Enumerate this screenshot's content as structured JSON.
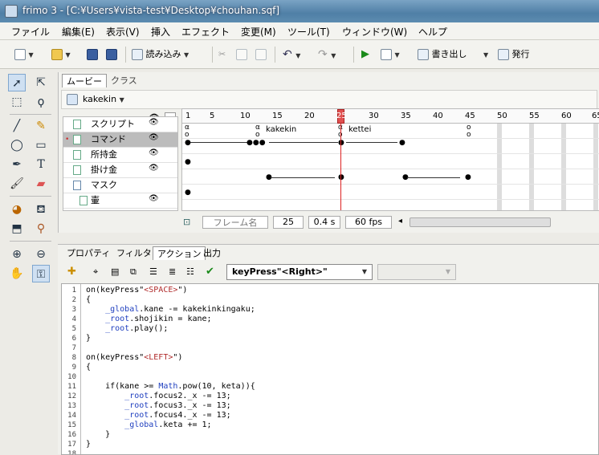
{
  "window": {
    "title": "frimo 3 - [C:¥Users¥vista-test¥Desktop¥chouhan.sqf]"
  },
  "menu": [
    "ファイル",
    "編集(E)",
    "表示(V)",
    "挿入",
    "エフェクト",
    "変更(M)",
    "ツール(T)",
    "ウィンドウ(W)",
    "ヘルプ"
  ],
  "toolbar": {
    "import_label": "読み込み",
    "export_label": "書き出し",
    "publish_label": "発行"
  },
  "timeline": {
    "tabs": [
      "ムービー",
      "クラス"
    ],
    "scene": "kakekin",
    "ruler_ticks": [
      "1",
      "5",
      "10",
      "15",
      "20",
      "25",
      "30",
      "35",
      "40",
      "45",
      "50",
      "55",
      "60",
      "65"
    ],
    "frame_labels": [
      "kakekin",
      "kettei"
    ],
    "layers": [
      {
        "name": "スクリプト"
      },
      {
        "name": "コマンド"
      },
      {
        "name": "所持金"
      },
      {
        "name": "掛け金"
      },
      {
        "name": "マスク"
      },
      {
        "name": "壷"
      }
    ],
    "status": {
      "frame_name_placeholder": "フレーム名",
      "frame": "25",
      "time": "0.4 s",
      "fps": "60 fps"
    }
  },
  "panel": {
    "tabs": [
      "プロパティ",
      "フィルタ",
      "アクション",
      "出力"
    ],
    "event_select": "keyPress\"<Right>\"",
    "lines": [
      {
        "n": "1",
        "text": "on(keyPress\"<SPACE>\")"
      },
      {
        "n": "2",
        "text": "{"
      },
      {
        "n": "3",
        "text": "    _global.kane -= kakekinkingaku;"
      },
      {
        "n": "4",
        "text": "    _root.shojikin = kane;"
      },
      {
        "n": "5",
        "text": "    _root.play();"
      },
      {
        "n": "6",
        "text": "}"
      },
      {
        "n": "7",
        "text": ""
      },
      {
        "n": "8",
        "text": "on(keyPress\"<LEFT>\")"
      },
      {
        "n": "9",
        "text": "{"
      },
      {
        "n": "10",
        "text": ""
      },
      {
        "n": "11",
        "text": "    if(kane >= Math.pow(10, keta)){"
      },
      {
        "n": "12",
        "text": "        _root.focus2._x -= 13;"
      },
      {
        "n": "13",
        "text": "        _root.focus3._x -= 13;"
      },
      {
        "n": "14",
        "text": "        _root.focus4._x -= 13;"
      },
      {
        "n": "15",
        "text": "        _global.keta += 1;"
      },
      {
        "n": "16",
        "text": "    }"
      },
      {
        "n": "17",
        "text": "}"
      },
      {
        "n": "18",
        "text": ""
      }
    ]
  },
  "colors": {
    "title_bar": "#4f7fa6",
    "playhead": "#e05050",
    "keyword": "#1f3fbf",
    "string": "#b02b2b"
  }
}
